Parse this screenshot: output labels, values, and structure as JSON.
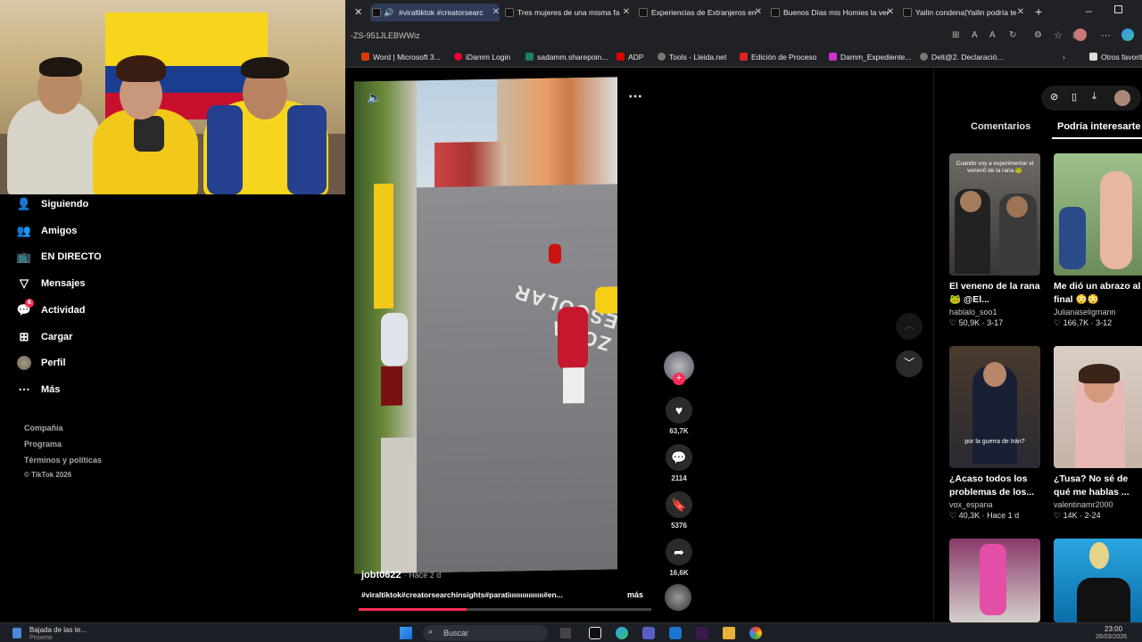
{
  "browser": {
    "tabs": [
      {
        "label": "#viraltiktok #creatorsearc",
        "active": true
      },
      {
        "label": "Tres mujeres de una misma fa",
        "active": false
      },
      {
        "label": "Experiencias de Extranjeros en",
        "active": false
      },
      {
        "label": "Buenos Días mis Homies la ver",
        "active": false
      },
      {
        "label": "Yailin condena|Yailin podría te",
        "active": false
      }
    ],
    "url": "-ZS-951JLEBWWiz",
    "bookmarks": [
      "Word | Microsoft 3...",
      "iDamm Login",
      "sadamm.sharepoin...",
      "ADP",
      "Tools - Lleida.net",
      "Edición de Proceso",
      "Damm_Expediente...",
      "Delt@2. Declaració...",
      "Otros favorit"
    ]
  },
  "sidebar": {
    "items": [
      {
        "label": "Siguiendo",
        "icon": "user-follow-icon"
      },
      {
        "label": "Amigos",
        "icon": "friends-icon"
      },
      {
        "label": "EN DIRECTO",
        "icon": "live-icon"
      },
      {
        "label": "Mensajes",
        "icon": "messages-icon"
      },
      {
        "label": "Actividad",
        "icon": "activity-icon",
        "badge": "6"
      },
      {
        "label": "Cargar",
        "icon": "upload-icon"
      },
      {
        "label": "Perfil",
        "icon": "avatar-icon"
      },
      {
        "label": "Más",
        "icon": "more-icon"
      }
    ],
    "footer": [
      "Compañía",
      "Programa",
      "Términos y políticas",
      "© TikTok 2026"
    ]
  },
  "video": {
    "author": "jobt0622",
    "time": "· Hace 2 d",
    "caption": "#viraltiktok#creatorsearchinsights#paratiıııııııııııııııı#en...",
    "more": "más",
    "progress": 0.37,
    "street_text": "ZONA ESCOLAR"
  },
  "actions": {
    "likes": "63,7K",
    "comments": "2114",
    "saves": "5376",
    "shares": "16,6K"
  },
  "right_panel": {
    "tabs": [
      "Comentarios",
      "Podría interesarte"
    ],
    "active_tab": "Podría interesarte",
    "cards": [
      {
        "title": "El veneno de la rana 🐸 @El...",
        "author": "hablalo_soo1",
        "likes": "50,9K",
        "date": "3-17",
        "overlay": "Cuando voy a experimentar el venen0 de la rana 🐸"
      },
      {
        "title": "Me dió un abrazo al final 😳😳",
        "author": "Julianaseligmann",
        "likes": "166,7K",
        "date": "3-12",
        "overlay": ""
      },
      {
        "title": "¿Acaso todos los problemas de los...",
        "author": "vox_espana",
        "likes": "40,3K",
        "date": "Hace 1 d",
        "overlay": "por la guerra de Irán?"
      },
      {
        "title": "¿Tusa? No sé de qué me hablas ...",
        "author": "valentinamr2000",
        "likes": "14K",
        "date": "2-24",
        "overlay": ""
      },
      {
        "title": "",
        "author": "",
        "likes": "",
        "date": "",
        "overlay": ""
      },
      {
        "title": "",
        "author": "",
        "likes": "",
        "date": "",
        "overlay": ""
      }
    ]
  },
  "taskbar": {
    "weather": "Bajada de las te...",
    "weather_sub": "Próximo",
    "search": "Buscar",
    "time": "23:00",
    "date": "26/03/2026"
  },
  "colors": {
    "accent": "#fe2c55",
    "tab_active": "#2e3a57"
  }
}
